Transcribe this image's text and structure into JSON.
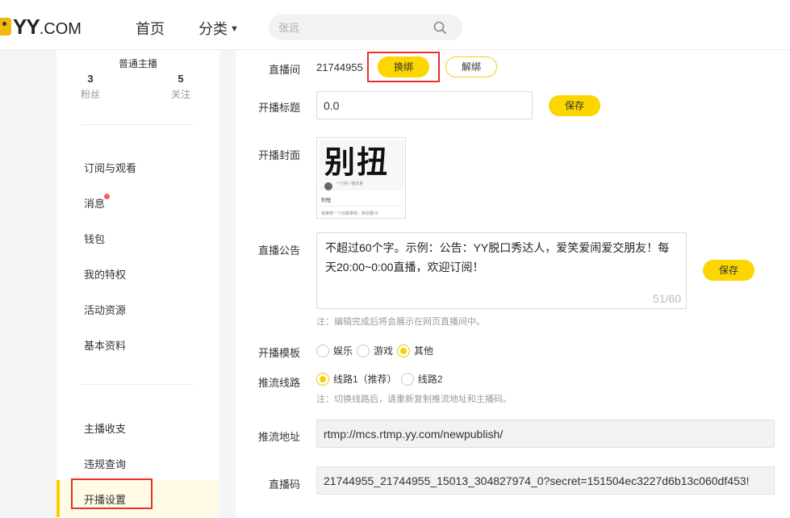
{
  "header": {
    "logo_text": "YY",
    "logo_suffix": ".COM",
    "nav": {
      "home": "首页",
      "category": "分类"
    },
    "search": {
      "placeholder": "张远"
    }
  },
  "sidebar": {
    "user_title": "普通主播",
    "fans": {
      "count": "3",
      "label": "粉丝"
    },
    "follow": {
      "count": "5",
      "label": "关注"
    },
    "items": [
      {
        "label": "订阅与观看"
      },
      {
        "label": "消息",
        "has_badge": true
      },
      {
        "label": "钱包"
      },
      {
        "label": "我的特权"
      },
      {
        "label": "活动资源"
      },
      {
        "label": "基本资料"
      },
      {
        "label": "主播收支"
      },
      {
        "label": "违规查询"
      },
      {
        "label": "开播设置",
        "active": true
      }
    ]
  },
  "main": {
    "room": {
      "label": "直播间",
      "id": "21744955",
      "change_button": "换绑",
      "unbind_button": "解绑"
    },
    "title": {
      "label": "开播标题",
      "value": "0.0",
      "save_button": "保存"
    },
    "cover": {
      "label": "开播封面",
      "big_text": "别扭",
      "meta": "一分钟 / 播放量",
      "name": "别扭",
      "desc": "我推荐一个旧歌推荐，辨别量10"
    },
    "notice": {
      "label": "直播公告",
      "text": "不超过60个字。示例：公告：YY脱口秀达人，爱笑爱闹爱交朋友！每天20:00~0:00直播，欢迎订阅！",
      "counter": "51/60",
      "save_button": "保存",
      "note": "注：编辑完成后将会展示在网页直播间中。"
    },
    "template": {
      "label": "开播模板",
      "options": [
        {
          "label": "娱乐",
          "selected": false
        },
        {
          "label": "游戏",
          "selected": false
        },
        {
          "label": "其他",
          "selected": true
        }
      ]
    },
    "line": {
      "label": "推流线路",
      "options": [
        {
          "label": "线路1（推荐）",
          "selected": true
        },
        {
          "label": "线路2",
          "selected": false
        }
      ],
      "note": "注：切换线路后，请重新复制推流地址和主播码。"
    },
    "push_url": {
      "label": "推流地址",
      "value": "rtmp://mcs.rtmp.yy.com/newpublish/"
    },
    "stream_code": {
      "label": "直播码",
      "value": "21744955_21744955_15013_304827974_0?secret=151504ec3227d6b13c060df453!"
    }
  },
  "colors": {
    "accent": "#fcd600",
    "highlight_box": "#e8302e",
    "badge": "#ff5a5a"
  }
}
